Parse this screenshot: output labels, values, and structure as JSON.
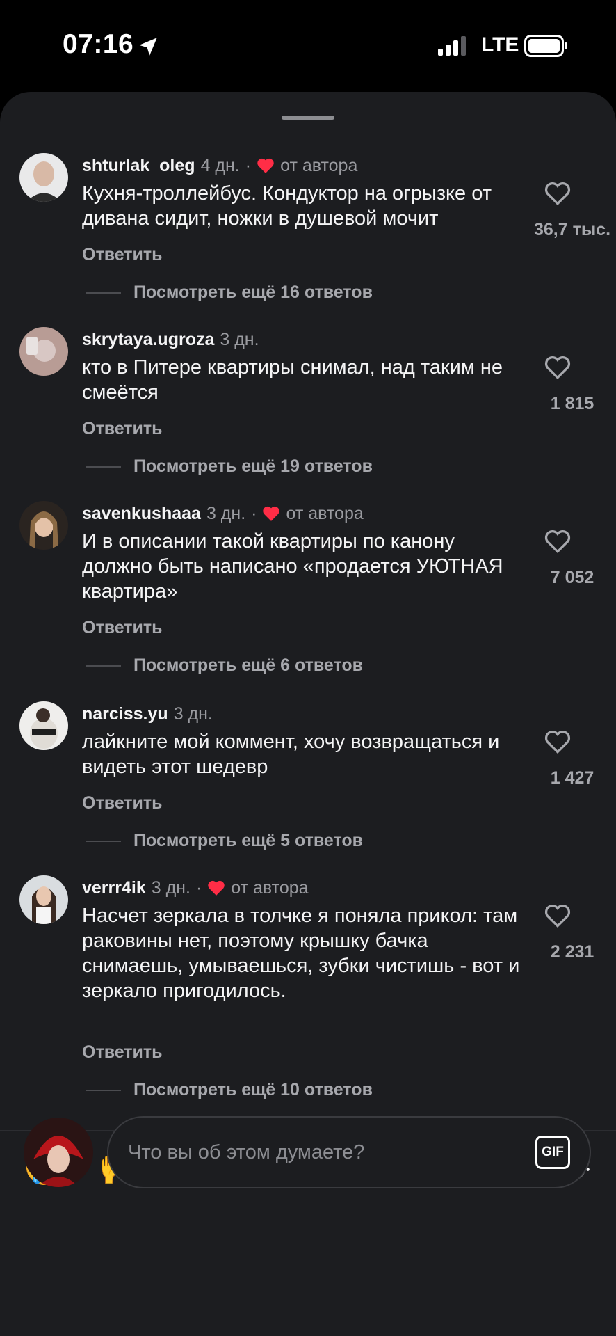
{
  "status_bar": {
    "time": "07:16",
    "network": "LTE",
    "icons": [
      "location-arrow-icon",
      "signal-bars-icon",
      "battery-icon"
    ]
  },
  "comments": [
    {
      "username": "shturlak_oleg",
      "time": "4 дн.",
      "separator": "·",
      "author_label": "от автора",
      "text": "Кухня-троллейбус. Кондуктор на огрызке от дивана сидит, ножки в душевой мочит",
      "reply": "Ответить",
      "likes": "36,7 тыс.",
      "more_replies": "Посмотреть ещё 16 ответов"
    },
    {
      "username": "skrytaya.ugroza",
      "time": "3 дн.",
      "text": "кто в Питере квартиры снимал, над таким не смеётся",
      "reply": "Ответить",
      "likes": "1 815",
      "more_replies": "Посмотреть ещё 19 ответов"
    },
    {
      "username": "savenkushaaa",
      "time": "3 дн.",
      "separator": "·",
      "author_label": "от автора",
      "text": "И в описании такой квартиры по канону должно быть написано «продается УЮТНАЯ квартира»",
      "reply": "Ответить",
      "likes": "7 052",
      "more_replies": "Посмотреть ещё 6 ответов"
    },
    {
      "username": "narciss.yu",
      "time": "3 дн.",
      "text": "лайкните мой коммент, хочу возвращаться и видеть этот шедевр",
      "reply": "Ответить",
      "likes": "1 427",
      "more_replies": "Посмотреть ещё 5 ответов"
    },
    {
      "username": "verrr4ik",
      "time": "3 дн.",
      "separator": "·",
      "author_label": "от автора",
      "text": "Насчет зеркала в толчке я поняла прикол: там раковины нет, поэтому крышку бачка снимаешь, умываешься, зубки чистишь - вот и зеркало пригодилось.",
      "reply": "Ответить",
      "likes": "2 231",
      "more_replies": "Посмотреть ещё 10 ответов"
    }
  ],
  "emoji_bar": [
    "🤣",
    "🙌",
    "🔥",
    "👏",
    "😢",
    "😍",
    "😮",
    "😂"
  ],
  "composer": {
    "placeholder": "Что вы об этом думаете?",
    "gif_label": "GIF"
  },
  "colors": {
    "sheet_bg": "#1c1d20",
    "author_heart": "#ff2d46",
    "secondary_text": "#9a9ba0"
  }
}
